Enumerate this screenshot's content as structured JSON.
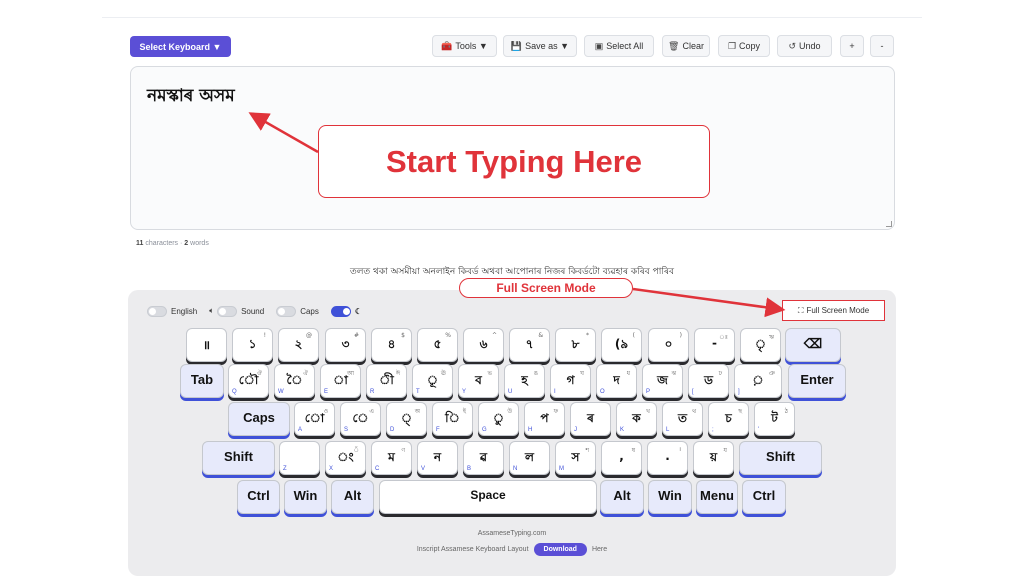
{
  "toolbar": {
    "select_keyboard": "Select Keyboard ▼",
    "tools": "Tools ▼",
    "save_as": "Save as ▼",
    "select_all": "Select All",
    "clear": "Clear",
    "copy": "Copy",
    "undo": "Undo",
    "zoom_in": "+",
    "zoom_out": "-"
  },
  "editor": {
    "text": "নমস্কাৰ অসম",
    "callout": "Start Typing Here"
  },
  "stats": {
    "characters": "11",
    "characters_label": "characters",
    "sep": "·",
    "words": "2",
    "words_label": "words"
  },
  "subtitle": "তলত থকা অসমীয়া অনলাইন কিবৰ্ড অথবা আপোনাৰ নিজৰ কিবৰ্ডটো ব্যৱহাৰ কৰিব পাৰিব",
  "fullscreen_callout": "Full Screen Mode",
  "toggles": {
    "english": "English",
    "sound": "Sound",
    "caps": "Caps",
    "dark": "☾"
  },
  "fullscreen_button": "Full Screen Mode",
  "colors": {
    "accent": "#5b4fd6",
    "annotation": "#e0333a",
    "key_shadow_fn": "#3f51d8"
  },
  "keys": {
    "row1": [
      {
        "main": "॥",
        "sup": ""
      },
      {
        "main": "১",
        "sup": "!"
      },
      {
        "main": "২",
        "sup": "@"
      },
      {
        "main": "৩",
        "sup": "#"
      },
      {
        "main": "৪",
        "sup": "$"
      },
      {
        "main": "৫",
        "sup": "%"
      },
      {
        "main": "৬",
        "sup": "^"
      },
      {
        "main": "৭",
        "sup": "&"
      },
      {
        "main": "৮",
        "sup": "*"
      },
      {
        "main": "(৯",
        "sup": "("
      },
      {
        "main": "০",
        "sup": ")"
      },
      {
        "main": "-",
        "sup": "ঃ"
      },
      {
        "main": "ৃ",
        "sup": "ঋ"
      },
      {
        "main": "⌫",
        "sup": ""
      }
    ],
    "row2": [
      {
        "main": "Tab",
        "sup": "",
        "lat": ""
      },
      {
        "main": "ৌ",
        "sup": "ঔ",
        "lat": "Q"
      },
      {
        "main": "ৈ",
        "sup": "ঐ",
        "lat": "W"
      },
      {
        "main": "া",
        "sup": "আ",
        "lat": "E"
      },
      {
        "main": "ী",
        "sup": "ঈ",
        "lat": "R"
      },
      {
        "main": "ূ",
        "sup": "ঊ",
        "lat": "T"
      },
      {
        "main": "ব",
        "sup": "ভ",
        "lat": "Y"
      },
      {
        "main": "হ",
        "sup": "ঙ",
        "lat": "U"
      },
      {
        "main": "গ",
        "sup": "ঘ",
        "lat": "I"
      },
      {
        "main": "দ",
        "sup": "ধ",
        "lat": "O"
      },
      {
        "main": "জ",
        "sup": "ঝ",
        "lat": "P"
      },
      {
        "main": "ড",
        "sup": "ঢ",
        "lat": "["
      },
      {
        "main": "়",
        "sup": "ঞ",
        "lat": "]"
      },
      {
        "main": "Enter",
        "sup": "",
        "lat": ""
      }
    ],
    "row3": [
      {
        "main": "Caps",
        "sup": "",
        "lat": ""
      },
      {
        "main": "ো",
        "sup": "ও",
        "lat": "A"
      },
      {
        "main": "ে",
        "sup": "এ",
        "lat": "S"
      },
      {
        "main": "্",
        "sup": "অ",
        "lat": "D"
      },
      {
        "main": "ি",
        "sup": "ই",
        "lat": "F"
      },
      {
        "main": "ু",
        "sup": "উ",
        "lat": "G"
      },
      {
        "main": "প",
        "sup": "ফ",
        "lat": "H"
      },
      {
        "main": "ৰ",
        "sup": "",
        "lat": "J"
      },
      {
        "main": "ক",
        "sup": "খ",
        "lat": "K"
      },
      {
        "main": "ত",
        "sup": "থ",
        "lat": "L"
      },
      {
        "main": "চ",
        "sup": "ছ",
        "lat": ";"
      },
      {
        "main": "ট",
        "sup": "ঠ",
        "lat": "'"
      }
    ],
    "row4": [
      {
        "main": "Shift",
        "sup": "",
        "lat": ""
      },
      {
        "main": "",
        "sup": "",
        "lat": "Z"
      },
      {
        "main": "ং",
        "sup": "ঁ",
        "lat": "X"
      },
      {
        "main": "ম",
        "sup": "ণ",
        "lat": "C"
      },
      {
        "main": "ন",
        "sup": "",
        "lat": "V"
      },
      {
        "main": "ৱ",
        "sup": "",
        "lat": "B"
      },
      {
        "main": "ল",
        "sup": "",
        "lat": "N"
      },
      {
        "main": "স",
        "sup": "শ",
        "lat": "M"
      },
      {
        "main": ",",
        "sup": "ষ",
        "lat": ""
      },
      {
        "main": ".",
        "sup": "।",
        "lat": ""
      },
      {
        "main": "য়",
        "sup": "য",
        "lat": ""
      },
      {
        "main": "Shift",
        "sup": "",
        "lat": ""
      }
    ],
    "row5": [
      {
        "main": "Ctrl"
      },
      {
        "main": "Win"
      },
      {
        "main": "Alt"
      },
      {
        "main": "Space"
      },
      {
        "main": "Alt"
      },
      {
        "main": "Win"
      },
      {
        "main": "Menu"
      },
      {
        "main": "Ctrl"
      }
    ]
  },
  "footer": {
    "site": "AssameseTyping.com",
    "layout_text": "Inscript Assamese Keyboard Layout",
    "download": "Download",
    "here": "Here"
  }
}
